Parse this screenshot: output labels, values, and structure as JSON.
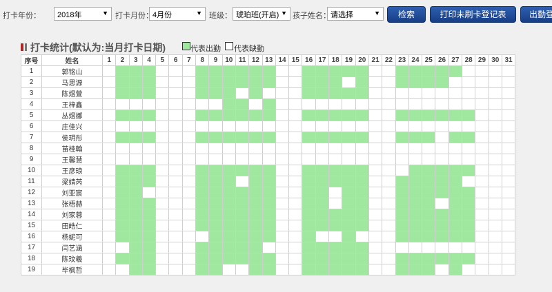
{
  "filters": {
    "year_label": "打卡年份：",
    "year_value": "2018年",
    "month_label": "打卡月份：",
    "month_value": "4月份",
    "class_label": "班级：",
    "class_value": "琥珀班(开启)",
    "child_label": "孩子姓名：",
    "child_value": "请选择"
  },
  "buttons": {
    "search": "检索",
    "print_unswiped": "打印未刷卡登记表",
    "attendance": "出勤登"
  },
  "section": {
    "title": "打卡统计(默认为:当月打卡日期)",
    "legend_present": "代表出勤",
    "legend_absent": "代表缺勤"
  },
  "colors": {
    "present": "#a0e8a0",
    "absent": "#ffffff",
    "button": "#1f4a98"
  },
  "table": {
    "col_index": "序号",
    "col_name": "姓名",
    "days": [
      1,
      2,
      3,
      4,
      5,
      6,
      7,
      8,
      9,
      10,
      11,
      12,
      13,
      14,
      15,
      16,
      17,
      18,
      19,
      20,
      21,
      22,
      23,
      24,
      25,
      26,
      27,
      28,
      29,
      30,
      31
    ],
    "rows": [
      {
        "index": "1",
        "name": "郭铭山",
        "present": [
          2,
          3,
          4,
          8,
          9,
          10,
          11,
          12,
          13,
          16,
          17,
          18,
          19,
          20,
          23,
          24,
          25,
          26,
          27
        ]
      },
      {
        "index": "2",
        "name": "马思源",
        "present": [
          2,
          3,
          4,
          8,
          9,
          10,
          11,
          12,
          13,
          16,
          17,
          18,
          20,
          23,
          24,
          25,
          26
        ]
      },
      {
        "index": "3",
        "name": "陈煜萱",
        "present": [
          2,
          3,
          4,
          8,
          9,
          10,
          12,
          16,
          17,
          18,
          19,
          20
        ]
      },
      {
        "index": "4",
        "name": "王梓鑫",
        "present": [
          10,
          11,
          13
        ]
      },
      {
        "index": "5",
        "name": "丛煜娜",
        "present": [
          2,
          3,
          4,
          8,
          9,
          10,
          11,
          12,
          13,
          16,
          17,
          18,
          19,
          20,
          23,
          24,
          25,
          26,
          27,
          28
        ]
      },
      {
        "index": "6",
        "name": "庄佳兴",
        "present": []
      },
      {
        "index": "7",
        "name": "侯玥彤",
        "present": [
          2,
          3,
          4,
          8,
          9,
          10,
          11,
          12,
          13,
          16,
          17,
          18,
          19,
          20,
          23,
          24,
          25,
          27,
          28
        ]
      },
      {
        "index": "8",
        "name": "苗桂翰",
        "present": []
      },
      {
        "index": "9",
        "name": "王馨慧",
        "present": []
      },
      {
        "index": "10",
        "name": "王彦琅",
        "present": [
          2,
          3,
          4,
          8,
          9,
          10,
          11,
          12,
          13,
          16,
          17,
          18,
          19,
          20,
          24,
          25,
          26,
          27,
          28
        ]
      },
      {
        "index": "11",
        "name": "梁婧芮",
        "present": [
          2,
          3,
          4,
          8,
          9,
          10,
          12,
          13,
          16,
          17,
          18,
          19,
          20,
          23,
          24,
          25,
          26,
          27
        ]
      },
      {
        "index": "12",
        "name": "刘亚宸",
        "present": [
          2,
          3,
          8,
          9,
          10,
          11,
          12,
          13,
          16,
          17,
          19,
          20,
          23,
          24,
          25,
          26,
          27,
          28
        ]
      },
      {
        "index": "13",
        "name": "张梧赫",
        "present": [
          2,
          3,
          4,
          8,
          9,
          10,
          11,
          12,
          13,
          16,
          17,
          19,
          20,
          23,
          24,
          25,
          27,
          28
        ]
      },
      {
        "index": "14",
        "name": "刘家蓉",
        "present": [
          2,
          3,
          4,
          8,
          9,
          10,
          11,
          12,
          13,
          16,
          17,
          18,
          19,
          20,
          23,
          24,
          25,
          26,
          27,
          28
        ]
      },
      {
        "index": "15",
        "name": "田皓仁",
        "present": [
          2,
          3,
          4,
          8,
          9,
          10,
          11,
          12,
          13,
          16,
          17,
          18,
          19,
          20,
          23,
          24,
          25,
          26,
          27,
          28
        ]
      },
      {
        "index": "16",
        "name": "杨妮可",
        "present": [
          2,
          3,
          4,
          9,
          10,
          11,
          12,
          13,
          16,
          19,
          23,
          24,
          25,
          26,
          27,
          28
        ]
      },
      {
        "index": "17",
        "name": "闫艺涵",
        "present": [
          3,
          4,
          8,
          9,
          10,
          11,
          12,
          16,
          17,
          18,
          19,
          20
        ]
      },
      {
        "index": "18",
        "name": "陈玟羲",
        "present": [
          2,
          3,
          4,
          8,
          9,
          10,
          11,
          12,
          13,
          16,
          17,
          18,
          19,
          20,
          23,
          24,
          25,
          26,
          27,
          28
        ]
      },
      {
        "index": "19",
        "name": "毕枫哲",
        "present": [
          3,
          4,
          8,
          9,
          12,
          13,
          16,
          17,
          18,
          19,
          20,
          23,
          24,
          25,
          27
        ]
      }
    ]
  }
}
